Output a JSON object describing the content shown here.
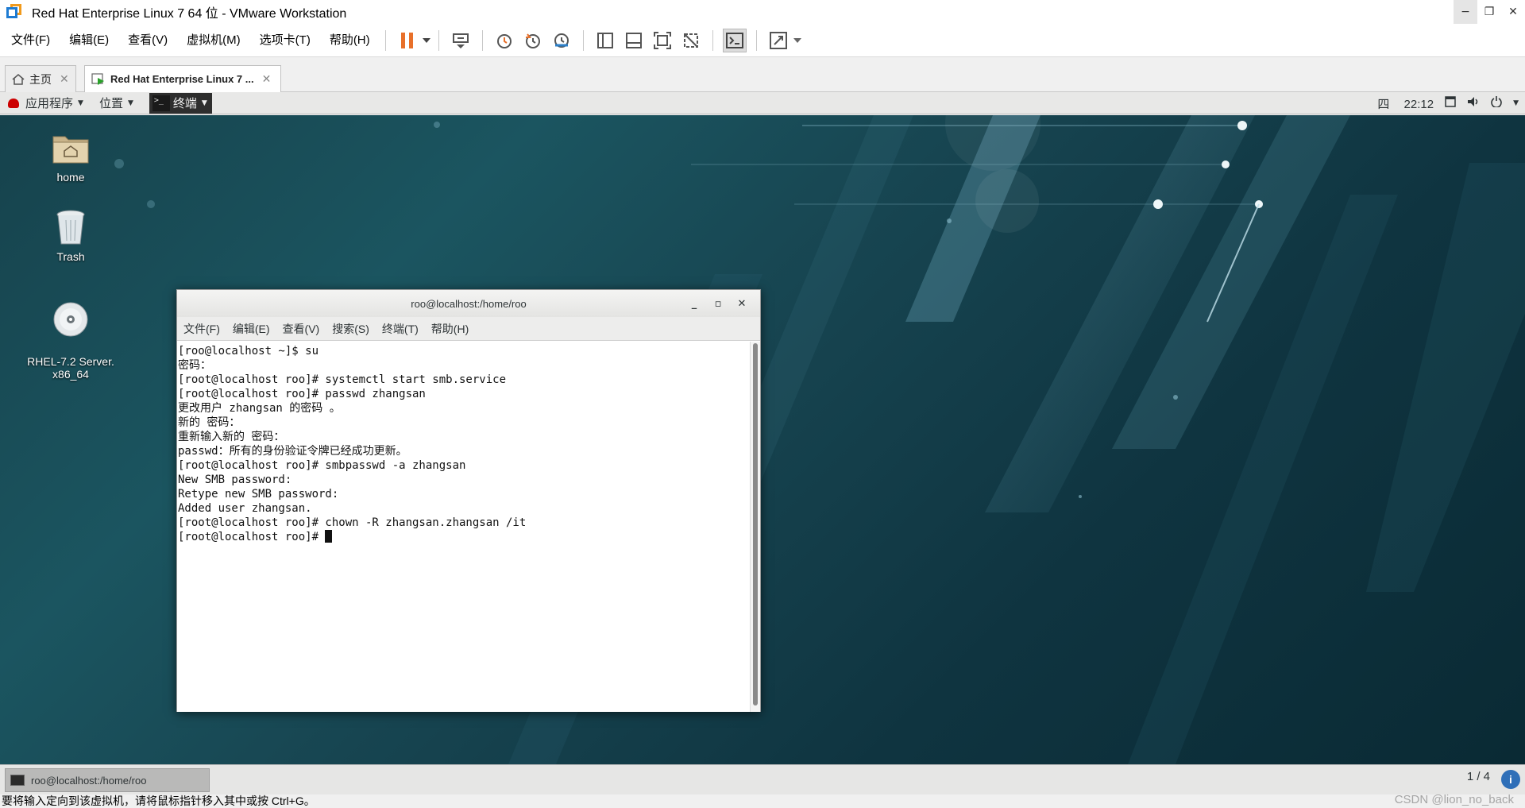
{
  "window": {
    "title": "Red Hat Enterprise Linux 7 64 位 - VMware Workstation",
    "min_glyph": "−",
    "restore_glyph": "❐",
    "close_glyph": "✕"
  },
  "menu": [
    "文件(F)",
    "编辑(E)",
    "查看(V)",
    "虚拟机(M)",
    "选项卡(T)",
    "帮助(H)"
  ],
  "tabs": {
    "home": {
      "label": "主页"
    },
    "vm": {
      "label": "Red Hat Enterprise Linux 7 ..."
    }
  },
  "gnome_top": {
    "apps": "应用程序",
    "places": "位置",
    "terminal": "终端",
    "day": "四",
    "time": "22:12"
  },
  "desktop": {
    "icons": [
      {
        "label": "home",
        "icon": "folder-home-icon"
      },
      {
        "label": "Trash",
        "icon": "trash-icon"
      },
      {
        "label": "RHEL-7.2 Server.\nx86_64",
        "icon": "disc-icon"
      }
    ]
  },
  "terminal": {
    "title": "roo@localhost:/home/roo",
    "menu": [
      "文件(F)",
      "编辑(E)",
      "查看(V)",
      "搜索(S)",
      "终端(T)",
      "帮助(H)"
    ],
    "lines": [
      "[roo@localhost ~]$ su",
      "密码：",
      "[root@localhost roo]# systemctl start smb.service",
      "[root@localhost roo]# passwd zhangsan",
      "更改用户 zhangsan 的密码 。",
      "新的 密码：",
      "重新输入新的 密码：",
      "passwd：所有的身份验证令牌已经成功更新。",
      "[root@localhost roo]# smbpasswd -a zhangsan",
      "New SMB password:",
      "Retype new SMB password:",
      "Added user zhangsan.",
      "[root@localhost roo]# chown -R zhangsan.zhangsan /it",
      "[root@localhost roo]# "
    ]
  },
  "taskbar": {
    "task_label": "roo@localhost:/home/roo",
    "workspace": "1 / 4",
    "info": "i"
  },
  "status": {
    "message": "要将输入定向到该虚拟机，请将鼠标指针移入其中或按 Ctrl+G。",
    "watermark": "CSDN @lion_no_back"
  },
  "colors": {
    "vmware_blue": "#1e7bd2",
    "vmware_orange": "#f19a1c",
    "pause_orange": "#e8702a",
    "desktop_teal": "#16424c"
  }
}
